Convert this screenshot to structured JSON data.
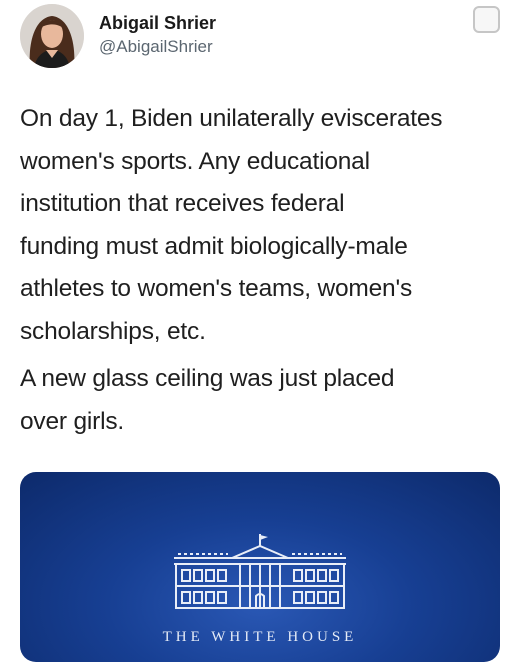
{
  "author": {
    "name": "Abigail Shrier",
    "handle": "@AbigailShrier"
  },
  "tweet": {
    "paragraph_1": "On day 1, Biden unilaterally eviscerates\nwomen's sports.  Any educational\ninstitution that receives federal\nfunding must admit biologically-male\nathletes to women's teams, women's\nscholarships, etc.",
    "paragraph_2": "A new glass ceiling was just placed\nover girls."
  },
  "media_card": {
    "caption": "THE WHITE HOUSE"
  },
  "icons": [
    "avatar-photo",
    "checkbox-icon",
    "white-house-logo"
  ],
  "colors": {
    "card_blue": "#173f93",
    "handle_gray": "#5b6670"
  }
}
